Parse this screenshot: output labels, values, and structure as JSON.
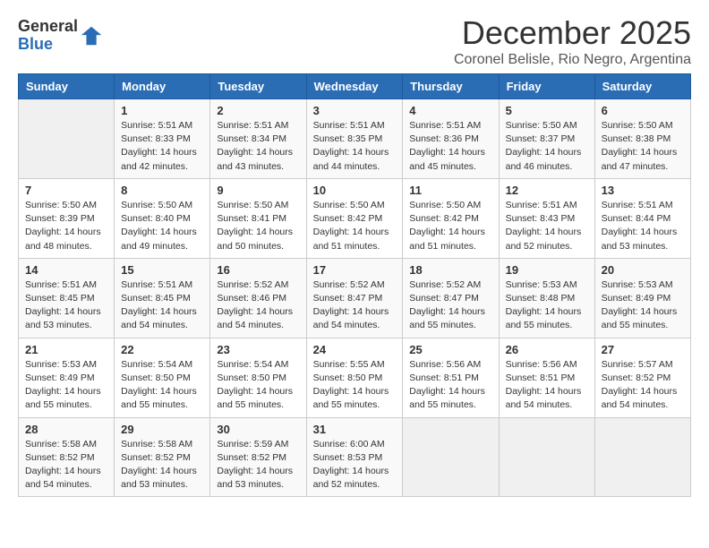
{
  "logo": {
    "general": "General",
    "blue": "Blue"
  },
  "title": "December 2025",
  "subtitle": "Coronel Belisle, Rio Negro, Argentina",
  "weekdays": [
    "Sunday",
    "Monday",
    "Tuesday",
    "Wednesday",
    "Thursday",
    "Friday",
    "Saturday"
  ],
  "weeks": [
    [
      {
        "day": "",
        "content": ""
      },
      {
        "day": "1",
        "content": "Sunrise: 5:51 AM\nSunset: 8:33 PM\nDaylight: 14 hours\nand 42 minutes."
      },
      {
        "day": "2",
        "content": "Sunrise: 5:51 AM\nSunset: 8:34 PM\nDaylight: 14 hours\nand 43 minutes."
      },
      {
        "day": "3",
        "content": "Sunrise: 5:51 AM\nSunset: 8:35 PM\nDaylight: 14 hours\nand 44 minutes."
      },
      {
        "day": "4",
        "content": "Sunrise: 5:51 AM\nSunset: 8:36 PM\nDaylight: 14 hours\nand 45 minutes."
      },
      {
        "day": "5",
        "content": "Sunrise: 5:50 AM\nSunset: 8:37 PM\nDaylight: 14 hours\nand 46 minutes."
      },
      {
        "day": "6",
        "content": "Sunrise: 5:50 AM\nSunset: 8:38 PM\nDaylight: 14 hours\nand 47 minutes."
      }
    ],
    [
      {
        "day": "7",
        "content": "Sunrise: 5:50 AM\nSunset: 8:39 PM\nDaylight: 14 hours\nand 48 minutes."
      },
      {
        "day": "8",
        "content": "Sunrise: 5:50 AM\nSunset: 8:40 PM\nDaylight: 14 hours\nand 49 minutes."
      },
      {
        "day": "9",
        "content": "Sunrise: 5:50 AM\nSunset: 8:41 PM\nDaylight: 14 hours\nand 50 minutes."
      },
      {
        "day": "10",
        "content": "Sunrise: 5:50 AM\nSunset: 8:42 PM\nDaylight: 14 hours\nand 51 minutes."
      },
      {
        "day": "11",
        "content": "Sunrise: 5:50 AM\nSunset: 8:42 PM\nDaylight: 14 hours\nand 51 minutes."
      },
      {
        "day": "12",
        "content": "Sunrise: 5:51 AM\nSunset: 8:43 PM\nDaylight: 14 hours\nand 52 minutes."
      },
      {
        "day": "13",
        "content": "Sunrise: 5:51 AM\nSunset: 8:44 PM\nDaylight: 14 hours\nand 53 minutes."
      }
    ],
    [
      {
        "day": "14",
        "content": "Sunrise: 5:51 AM\nSunset: 8:45 PM\nDaylight: 14 hours\nand 53 minutes."
      },
      {
        "day": "15",
        "content": "Sunrise: 5:51 AM\nSunset: 8:45 PM\nDaylight: 14 hours\nand 54 minutes."
      },
      {
        "day": "16",
        "content": "Sunrise: 5:52 AM\nSunset: 8:46 PM\nDaylight: 14 hours\nand 54 minutes."
      },
      {
        "day": "17",
        "content": "Sunrise: 5:52 AM\nSunset: 8:47 PM\nDaylight: 14 hours\nand 54 minutes."
      },
      {
        "day": "18",
        "content": "Sunrise: 5:52 AM\nSunset: 8:47 PM\nDaylight: 14 hours\nand 55 minutes."
      },
      {
        "day": "19",
        "content": "Sunrise: 5:53 AM\nSunset: 8:48 PM\nDaylight: 14 hours\nand 55 minutes."
      },
      {
        "day": "20",
        "content": "Sunrise: 5:53 AM\nSunset: 8:49 PM\nDaylight: 14 hours\nand 55 minutes."
      }
    ],
    [
      {
        "day": "21",
        "content": "Sunrise: 5:53 AM\nSunset: 8:49 PM\nDaylight: 14 hours\nand 55 minutes."
      },
      {
        "day": "22",
        "content": "Sunrise: 5:54 AM\nSunset: 8:50 PM\nDaylight: 14 hours\nand 55 minutes."
      },
      {
        "day": "23",
        "content": "Sunrise: 5:54 AM\nSunset: 8:50 PM\nDaylight: 14 hours\nand 55 minutes."
      },
      {
        "day": "24",
        "content": "Sunrise: 5:55 AM\nSunset: 8:50 PM\nDaylight: 14 hours\nand 55 minutes."
      },
      {
        "day": "25",
        "content": "Sunrise: 5:56 AM\nSunset: 8:51 PM\nDaylight: 14 hours\nand 55 minutes."
      },
      {
        "day": "26",
        "content": "Sunrise: 5:56 AM\nSunset: 8:51 PM\nDaylight: 14 hours\nand 54 minutes."
      },
      {
        "day": "27",
        "content": "Sunrise: 5:57 AM\nSunset: 8:52 PM\nDaylight: 14 hours\nand 54 minutes."
      }
    ],
    [
      {
        "day": "28",
        "content": "Sunrise: 5:58 AM\nSunset: 8:52 PM\nDaylight: 14 hours\nand 54 minutes."
      },
      {
        "day": "29",
        "content": "Sunrise: 5:58 AM\nSunset: 8:52 PM\nDaylight: 14 hours\nand 53 minutes."
      },
      {
        "day": "30",
        "content": "Sunrise: 5:59 AM\nSunset: 8:52 PM\nDaylight: 14 hours\nand 53 minutes."
      },
      {
        "day": "31",
        "content": "Sunrise: 6:00 AM\nSunset: 8:53 PM\nDaylight: 14 hours\nand 52 minutes."
      },
      {
        "day": "",
        "content": ""
      },
      {
        "day": "",
        "content": ""
      },
      {
        "day": "",
        "content": ""
      }
    ]
  ]
}
